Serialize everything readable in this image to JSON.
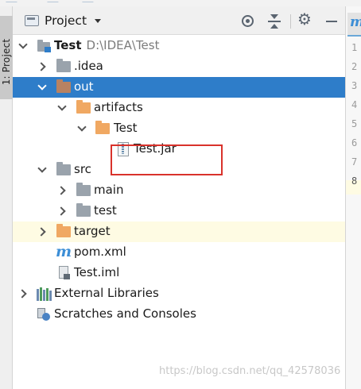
{
  "tool_window": {
    "side_tab_label": "1: Project",
    "title": "Project"
  },
  "tree": {
    "root": {
      "name": "Test",
      "path": "D:\\IDEA\\Test"
    },
    "idea": ".idea",
    "out": "out",
    "artifacts": "artifacts",
    "artifact_test": "Test",
    "jar": "Test.jar",
    "src": "src",
    "main": "main",
    "test": "test",
    "target": "target",
    "pom": "pom.xml",
    "iml": "Test.iml",
    "external_libraries": "External Libraries",
    "scratches": "Scratches and Consoles"
  },
  "editor": {
    "line_numbers": [
      "1",
      "2",
      "3",
      "4",
      "5",
      "6",
      "7",
      "8"
    ],
    "current_line": "8"
  },
  "watermark": "https://blog.csdn.net/qq_42578036",
  "colors": {
    "selection": "#2e7dc9",
    "highlight_row": "#fefbe3",
    "annotation_box": "#d9322b",
    "excluded_folder": "#b88262",
    "output_folder": "#f0a862"
  }
}
